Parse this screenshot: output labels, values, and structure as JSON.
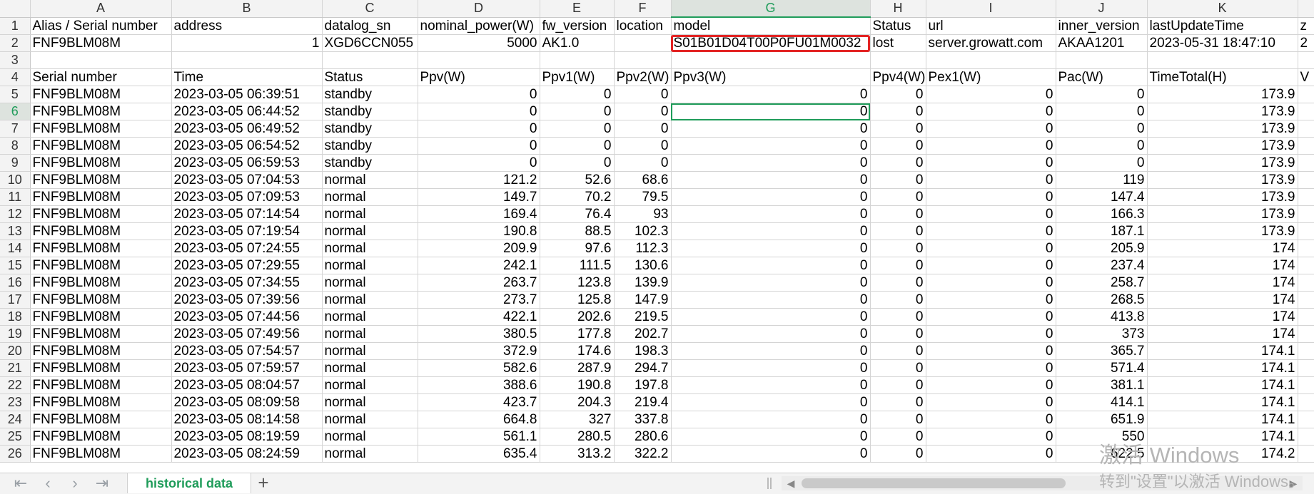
{
  "columns": [
    "A",
    "B",
    "C",
    "D",
    "E",
    "F",
    "G",
    "H",
    "I",
    "J",
    "K",
    ""
  ],
  "selected_column": "G",
  "header_row1": [
    "Alias / Serial number",
    "address",
    "datalog_sn",
    "nominal_power(W)",
    "fw_version",
    "location",
    "model",
    "Status",
    "url",
    "inner_version",
    "lastUpdateTime",
    "z"
  ],
  "row2": [
    "FNF9BLM08M",
    "1",
    "XGD6CCN055",
    "5000",
    "AK1.0",
    "",
    "S01B01D04T00P0FU01M0032",
    "lost",
    "server.growatt.com",
    "AKAA1201",
    "2023-05-31 18:47:10",
    "2"
  ],
  "header_row4": [
    "Serial number",
    "Time",
    "Status",
    "Ppv(W)",
    "Ppv1(W)",
    "Ppv2(W)",
    "Ppv3(W)",
    "Ppv4(W)",
    "Pex1(W)",
    "Pac(W)",
    "TimeTotal(H)",
    "V"
  ],
  "selected_row": "6",
  "data_rows": [
    {
      "n": "5",
      "cells": [
        "FNF9BLM08M",
        "2023-03-05 06:39:51",
        "standby",
        "0",
        "0",
        "0",
        "0",
        "0",
        "0",
        "0",
        "173.9",
        ""
      ]
    },
    {
      "n": "6",
      "cells": [
        "FNF9BLM08M",
        "2023-03-05 06:44:52",
        "standby",
        "0",
        "0",
        "0",
        "0",
        "0",
        "0",
        "0",
        "173.9",
        ""
      ]
    },
    {
      "n": "7",
      "cells": [
        "FNF9BLM08M",
        "2023-03-05 06:49:52",
        "standby",
        "0",
        "0",
        "0",
        "0",
        "0",
        "0",
        "0",
        "173.9",
        ""
      ]
    },
    {
      "n": "8",
      "cells": [
        "FNF9BLM08M",
        "2023-03-05 06:54:52",
        "standby",
        "0",
        "0",
        "0",
        "0",
        "0",
        "0",
        "0",
        "173.9",
        ""
      ]
    },
    {
      "n": "9",
      "cells": [
        "FNF9BLM08M",
        "2023-03-05 06:59:53",
        "standby",
        "0",
        "0",
        "0",
        "0",
        "0",
        "0",
        "0",
        "173.9",
        ""
      ]
    },
    {
      "n": "10",
      "cells": [
        "FNF9BLM08M",
        "2023-03-05 07:04:53",
        "normal",
        "121.2",
        "52.6",
        "68.6",
        "0",
        "0",
        "0",
        "119",
        "173.9",
        ""
      ]
    },
    {
      "n": "11",
      "cells": [
        "FNF9BLM08M",
        "2023-03-05 07:09:53",
        "normal",
        "149.7",
        "70.2",
        "79.5",
        "0",
        "0",
        "0",
        "147.4",
        "173.9",
        ""
      ]
    },
    {
      "n": "12",
      "cells": [
        "FNF9BLM08M",
        "2023-03-05 07:14:54",
        "normal",
        "169.4",
        "76.4",
        "93",
        "0",
        "0",
        "0",
        "166.3",
        "173.9",
        ""
      ]
    },
    {
      "n": "13",
      "cells": [
        "FNF9BLM08M",
        "2023-03-05 07:19:54",
        "normal",
        "190.8",
        "88.5",
        "102.3",
        "0",
        "0",
        "0",
        "187.1",
        "173.9",
        ""
      ]
    },
    {
      "n": "14",
      "cells": [
        "FNF9BLM08M",
        "2023-03-05 07:24:55",
        "normal",
        "209.9",
        "97.6",
        "112.3",
        "0",
        "0",
        "0",
        "205.9",
        "174",
        ""
      ]
    },
    {
      "n": "15",
      "cells": [
        "FNF9BLM08M",
        "2023-03-05 07:29:55",
        "normal",
        "242.1",
        "111.5",
        "130.6",
        "0",
        "0",
        "0",
        "237.4",
        "174",
        ""
      ]
    },
    {
      "n": "16",
      "cells": [
        "FNF9BLM08M",
        "2023-03-05 07:34:55",
        "normal",
        "263.7",
        "123.8",
        "139.9",
        "0",
        "0",
        "0",
        "258.7",
        "174",
        ""
      ]
    },
    {
      "n": "17",
      "cells": [
        "FNF9BLM08M",
        "2023-03-05 07:39:56",
        "normal",
        "273.7",
        "125.8",
        "147.9",
        "0",
        "0",
        "0",
        "268.5",
        "174",
        ""
      ]
    },
    {
      "n": "18",
      "cells": [
        "FNF9BLM08M",
        "2023-03-05 07:44:56",
        "normal",
        "422.1",
        "202.6",
        "219.5",
        "0",
        "0",
        "0",
        "413.8",
        "174",
        ""
      ]
    },
    {
      "n": "19",
      "cells": [
        "FNF9BLM08M",
        "2023-03-05 07:49:56",
        "normal",
        "380.5",
        "177.8",
        "202.7",
        "0",
        "0",
        "0",
        "373",
        "174",
        ""
      ]
    },
    {
      "n": "20",
      "cells": [
        "FNF9BLM08M",
        "2023-03-05 07:54:57",
        "normal",
        "372.9",
        "174.6",
        "198.3",
        "0",
        "0",
        "0",
        "365.7",
        "174.1",
        ""
      ]
    },
    {
      "n": "21",
      "cells": [
        "FNF9BLM08M",
        "2023-03-05 07:59:57",
        "normal",
        "582.6",
        "287.9",
        "294.7",
        "0",
        "0",
        "0",
        "571.4",
        "174.1",
        ""
      ]
    },
    {
      "n": "22",
      "cells": [
        "FNF9BLM08M",
        "2023-03-05 08:04:57",
        "normal",
        "388.6",
        "190.8",
        "197.8",
        "0",
        "0",
        "0",
        "381.1",
        "174.1",
        ""
      ]
    },
    {
      "n": "23",
      "cells": [
        "FNF9BLM08M",
        "2023-03-05 08:09:58",
        "normal",
        "423.7",
        "204.3",
        "219.4",
        "0",
        "0",
        "0",
        "414.1",
        "174.1",
        ""
      ]
    },
    {
      "n": "24",
      "cells": [
        "FNF9BLM08M",
        "2023-03-05 08:14:58",
        "normal",
        "664.8",
        "327",
        "337.8",
        "0",
        "0",
        "0",
        "651.9",
        "174.1",
        ""
      ]
    },
    {
      "n": "25",
      "cells": [
        "FNF9BLM08M",
        "2023-03-05 08:19:59",
        "normal",
        "561.1",
        "280.5",
        "280.6",
        "0",
        "0",
        "0",
        "550",
        "174.1",
        ""
      ]
    },
    {
      "n": "26",
      "cells": [
        "FNF9BLM08M",
        "2023-03-05 08:24:59",
        "normal",
        "635.4",
        "313.2",
        "322.2",
        "0",
        "0",
        "0",
        "622.5",
        "174.2",
        ""
      ]
    }
  ],
  "sheet_tab": "historical data",
  "watermark_line1": "激活 Windows",
  "watermark_line2": "转到\"设置\"以激活 Windows。"
}
